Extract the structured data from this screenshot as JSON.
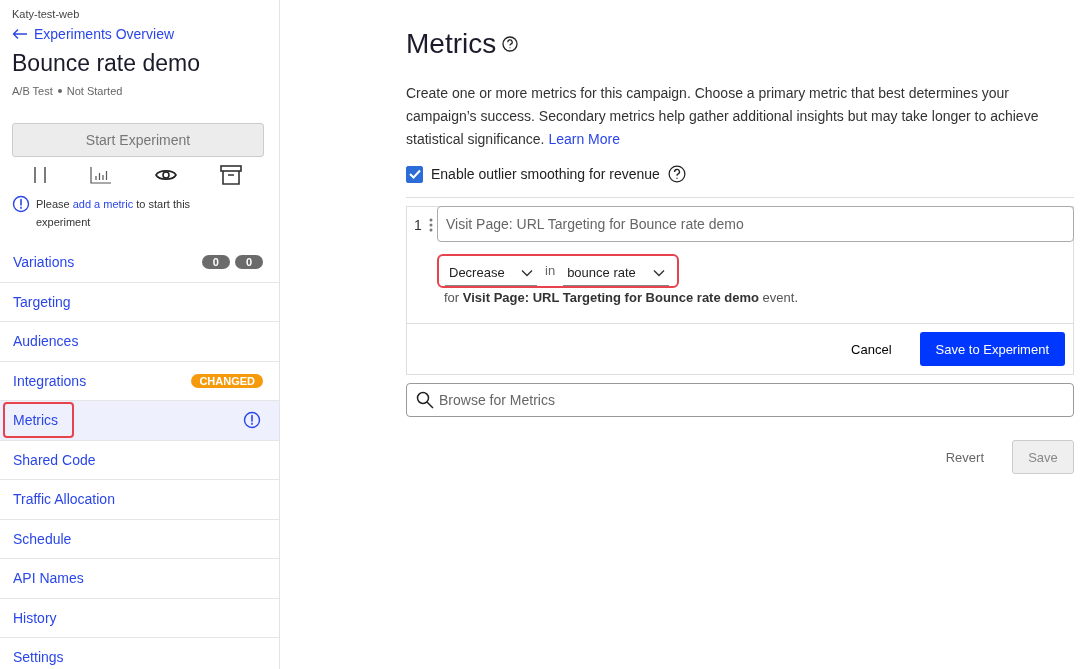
{
  "sidebar": {
    "project": "Katy-test-web",
    "back_link": "Experiments Overview",
    "title": "Bounce rate demo",
    "type": "A/B Test",
    "status": "Not Started",
    "start_button": {
      "label": "Start Experiment",
      "disabled": true
    },
    "notice": {
      "before": "Please",
      "link": "add a metric",
      "after": "to start this experiment"
    },
    "items": [
      {
        "label": "Variations",
        "selected": false,
        "highlighted": false,
        "warning": false,
        "badges": [
          "0",
          "0"
        ]
      },
      {
        "label": "Targeting",
        "selected": false,
        "highlighted": false,
        "warning": false
      },
      {
        "label": "Audiences",
        "selected": false,
        "highlighted": false,
        "warning": false
      },
      {
        "label": "Integrations",
        "selected": false,
        "highlighted": false,
        "warning": false,
        "tag": "CHANGED"
      },
      {
        "label": "Metrics",
        "selected": true,
        "highlighted": true,
        "warning": true
      },
      {
        "label": "Shared Code",
        "selected": false,
        "highlighted": false,
        "warning": false
      },
      {
        "label": "Traffic Allocation",
        "selected": false,
        "highlighted": false,
        "warning": false
      },
      {
        "label": "Schedule",
        "selected": false,
        "highlighted": false,
        "warning": false
      },
      {
        "label": "API Names",
        "selected": false,
        "highlighted": false,
        "warning": false
      },
      {
        "label": "History",
        "selected": false,
        "highlighted": false,
        "warning": false
      },
      {
        "label": "Settings",
        "selected": false,
        "highlighted": false,
        "warning": false
      }
    ]
  },
  "main": {
    "title": "Metrics",
    "description": "Create one or more metrics for this campaign. Choose a primary metric that best determines your campaign’s success. Secondary metrics help gather additional insights but may take longer to achieve statistical significance.",
    "learn_more": "Learn More",
    "outlier_checkbox": {
      "label": "Enable outlier smoothing for revenue",
      "checked": true
    },
    "metric": {
      "number": "1",
      "name": "Visit Page: URL Targeting for Bounce rate demo",
      "direction": "Decrease",
      "joiner": "in",
      "measure": "bounce rate",
      "highlighted": true,
      "summary": "for **Visit Page: URL Targeting for Bounce rate demo** event.",
      "cancel": "Cancel",
      "save": "Save to Experiment"
    },
    "browse": {
      "placeholder": "Browse for Metrics"
    },
    "revert": "Revert",
    "save": {
      "label": "Save",
      "disabled": true
    }
  }
}
